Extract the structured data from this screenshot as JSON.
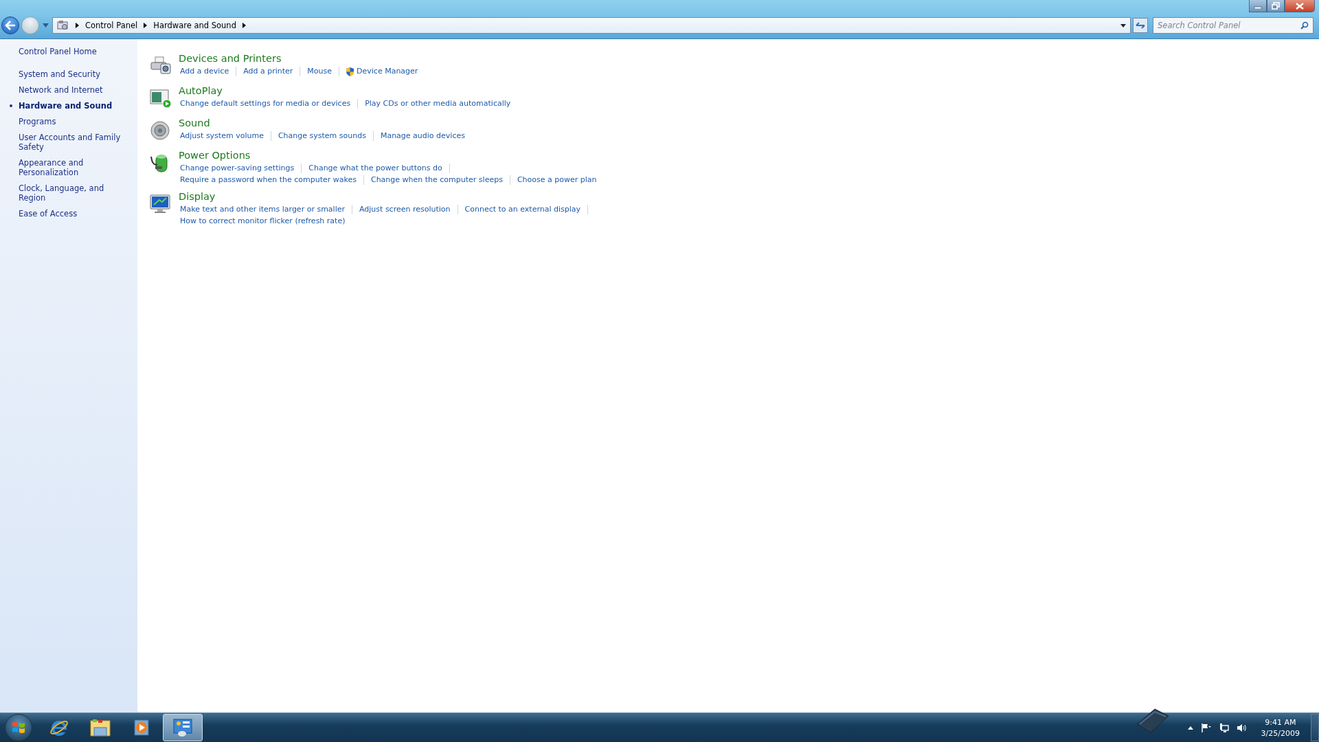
{
  "address_bar": {
    "breadcrumbs": [
      "Control Panel",
      "Hardware and Sound"
    ]
  },
  "search": {
    "placeholder": "Search Control Panel"
  },
  "sidebar": {
    "home": "Control Panel Home",
    "items": [
      {
        "label": "System and Security",
        "selected": false
      },
      {
        "label": "Network and Internet",
        "selected": false
      },
      {
        "label": "Hardware and Sound",
        "selected": true
      },
      {
        "label": "Programs",
        "selected": false
      },
      {
        "label": "User Accounts and Family Safety",
        "selected": false
      },
      {
        "label": "Appearance and Personalization",
        "selected": false
      },
      {
        "label": "Clock, Language, and Region",
        "selected": false
      },
      {
        "label": "Ease of Access",
        "selected": false
      }
    ]
  },
  "categories": [
    {
      "kind": "devices",
      "title": "Devices and Printers",
      "rows": [
        {
          "trailing_separator": false,
          "links": [
            {
              "label": "Add a device",
              "shield": false
            },
            {
              "label": "Add a printer",
              "shield": false
            },
            {
              "label": "Mouse",
              "shield": false
            },
            {
              "label": "Device Manager",
              "shield": true
            }
          ]
        }
      ]
    },
    {
      "kind": "autoplay",
      "title": "AutoPlay",
      "rows": [
        {
          "trailing_separator": false,
          "links": [
            {
              "label": "Change default settings for media or devices",
              "shield": false
            },
            {
              "label": "Play CDs or other media automatically",
              "shield": false
            }
          ]
        }
      ]
    },
    {
      "kind": "sound",
      "title": "Sound",
      "rows": [
        {
          "trailing_separator": false,
          "links": [
            {
              "label": "Adjust system volume",
              "shield": false
            },
            {
              "label": "Change system sounds",
              "shield": false
            },
            {
              "label": "Manage audio devices",
              "shield": false
            }
          ]
        }
      ]
    },
    {
      "kind": "power",
      "title": "Power Options",
      "rows": [
        {
          "trailing_separator": true,
          "links": [
            {
              "label": "Change power-saving settings",
              "shield": false
            },
            {
              "label": "Change what the power buttons do",
              "shield": false
            }
          ]
        },
        {
          "trailing_separator": false,
          "links": [
            {
              "label": "Require a password when the computer wakes",
              "shield": false
            },
            {
              "label": "Change when the computer sleeps",
              "shield": false
            },
            {
              "label": "Choose a power plan",
              "shield": false
            }
          ]
        }
      ]
    },
    {
      "kind": "display",
      "title": "Display",
      "rows": [
        {
          "trailing_separator": true,
          "links": [
            {
              "label": "Make text and other items larger or smaller",
              "shield": false
            },
            {
              "label": "Adjust screen resolution",
              "shield": false
            },
            {
              "label": "Connect to an external display",
              "shield": false
            }
          ]
        },
        {
          "trailing_separator": false,
          "links": [
            {
              "label": "How to correct monitor flicker (refresh rate)",
              "shield": false
            }
          ]
        }
      ]
    }
  ],
  "taskbar": {
    "apps": [
      {
        "kind": "browser",
        "selected": false
      },
      {
        "kind": "folder",
        "selected": false
      },
      {
        "kind": "media",
        "selected": false
      },
      {
        "kind": "control-panel",
        "selected": true
      }
    ],
    "tray": {
      "time": "9:41 AM",
      "date": "3/25/2009"
    }
  }
}
